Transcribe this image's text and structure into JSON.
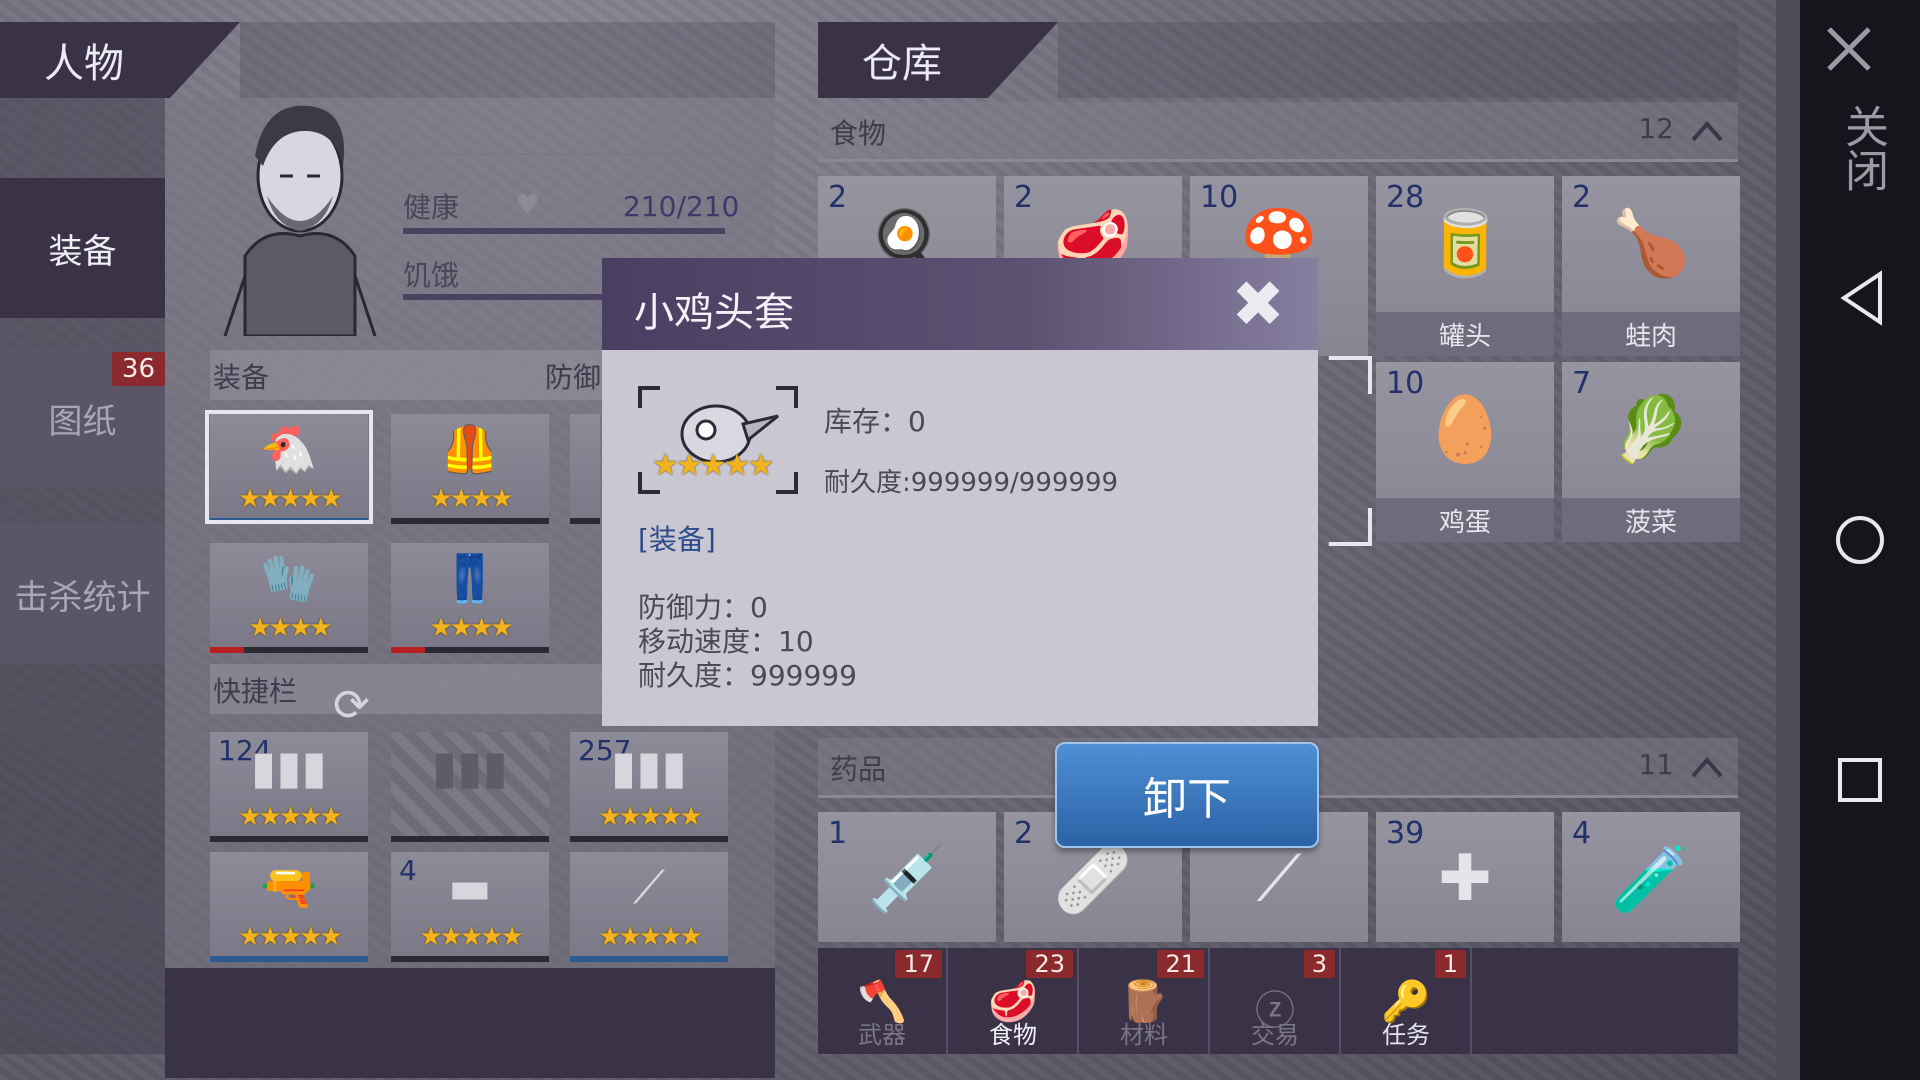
{
  "left": {
    "title": "人物",
    "tabs": [
      {
        "label": "装备",
        "active": true
      },
      {
        "label": "图纸",
        "badge": "36"
      },
      {
        "label": "击杀统计"
      }
    ],
    "stats": {
      "health_label": "健康",
      "health_value": "210/210",
      "hunger_label": "饥饿"
    },
    "equip_label": "装备",
    "defense_label": "防御",
    "quickbar_label": "快捷栏",
    "quickbar_counts": [
      "124",
      "257",
      "4"
    ]
  },
  "right": {
    "title": "仓库",
    "food": {
      "label": "食物",
      "count": "12",
      "items": [
        {
          "qty": "2"
        },
        {
          "qty": "2"
        },
        {
          "qty": "10"
        },
        {
          "qty": "28",
          "name": "罐头"
        },
        {
          "qty": "2",
          "name": "蛙肉"
        },
        {
          "qty": "10",
          "name": "鸡蛋"
        },
        {
          "qty": "7",
          "name": "菠菜"
        }
      ]
    },
    "medicine": {
      "label": "药品",
      "count": "11",
      "items": [
        {
          "qty": "1"
        },
        {
          "qty": "2"
        },
        {
          "qty": ""
        },
        {
          "qty": "39"
        },
        {
          "qty": "4"
        }
      ]
    },
    "bottom_tabs": [
      {
        "label": "武器",
        "badge": "17"
      },
      {
        "label": "食物",
        "badge": "23",
        "active": true
      },
      {
        "label": "材料",
        "badge": "21"
      },
      {
        "label": "交易",
        "badge": "3"
      },
      {
        "label": "任务",
        "badge": "1"
      }
    ]
  },
  "dialog": {
    "title": "小鸡头套",
    "stock": "库存：0",
    "durability_line": "耐久度:999999/999999",
    "type_link": "[装备]",
    "defense": "防御力：0",
    "speed": "移动速度：10",
    "durability": "耐久度：999999",
    "stars": "★★★★★",
    "unequip_label": "卸下"
  },
  "side": {
    "close_label": "关闭"
  },
  "colors": {
    "header_bg": "#3a3348",
    "star": "#f2b31c",
    "button_blue": "#3a78c0",
    "badge_red": "#8a2a2c"
  }
}
